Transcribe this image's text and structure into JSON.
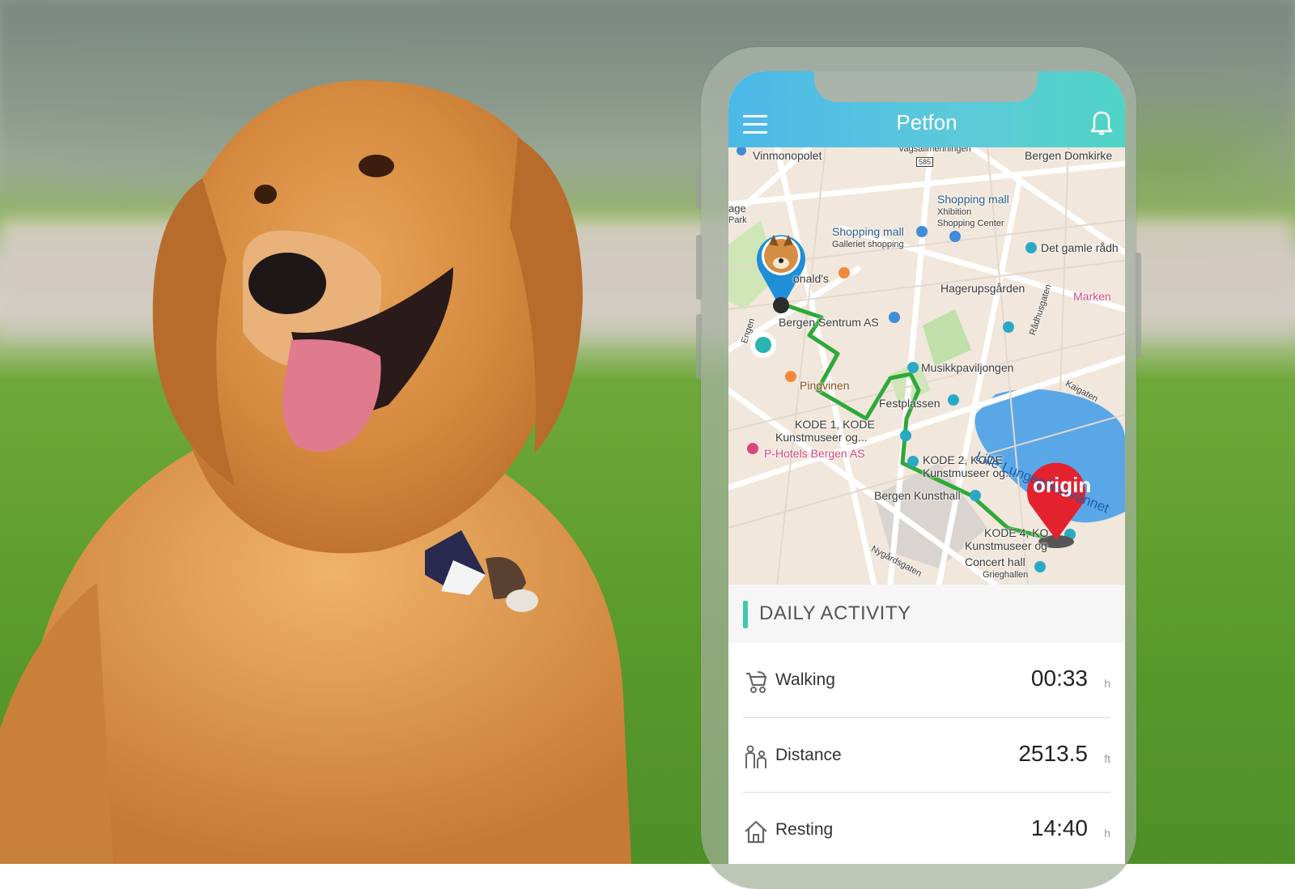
{
  "app": {
    "title": "Petfon"
  },
  "map": {
    "labels": {
      "vinmonopolet": "Vinmonopolet",
      "vagsallmenningen": "Vagsallmenningen",
      "route585": "585",
      "bergen_domkirke": "Bergen Domkirke",
      "age": "age",
      "park": "Park",
      "shopping_mall_1": "Shopping mall",
      "xhibition": "Xhibition",
      "xhibition_sub": "Shopping Center",
      "shopping_mall_2": "Shopping mall",
      "galleriet": "Galleriet shopping",
      "det_gamle": "Det gamle rådh",
      "mcdonalds": "onald's",
      "hagerupsgarden": "Hagerupsgården",
      "marken": "Marken",
      "bergen_sentrum": "Bergen Sentrum AS",
      "musikkpaviljongen": "Musikkpaviljongen",
      "pingvinen": "Pingvinen",
      "festplassen": "Festplassen",
      "kode1": "KODE 1, KODE",
      "kode1_sub": "Kunstmuseer og...",
      "p_hotels": "P-Hotels Bergen AS",
      "kode2": "KODE 2, KODE",
      "kode2_sub": "Kunstmuseer og...",
      "lille_lungegard": "Lille Lungegårdsvannet",
      "bergen_kunsthall": "Bergen Kunsthall",
      "kode4": "KODE 4, KO",
      "kode4_sub": "Kunstmuseer og",
      "concert_hall": "Concert hall",
      "grieghallen": "Grieghallen",
      "nygardsgaten": "Nygårdsgaten",
      "kaigaten": "Kaigaten",
      "radhusgaten": "Rådhusgaten",
      "engen": "Engen",
      "origin": "origin"
    }
  },
  "activity": {
    "title": "DAILY ACTIVITY",
    "rows": [
      {
        "label": "Walking",
        "value": "00:33",
        "unit": "h",
        "icon": "stroller-icon"
      },
      {
        "label": "Distance",
        "value": "2513.5",
        "unit": "ft",
        "icon": "people-icon"
      },
      {
        "label": "Resting",
        "value": "14:40",
        "unit": "h",
        "icon": "home-icon"
      }
    ]
  },
  "colors": {
    "header_start": "#4bb8e8",
    "header_end": "#4fd3c5",
    "route": "#2fa83a",
    "accent": "#3ec8b1",
    "origin_pin": "#e3222e",
    "pet_pin": "#1e8fd6"
  }
}
